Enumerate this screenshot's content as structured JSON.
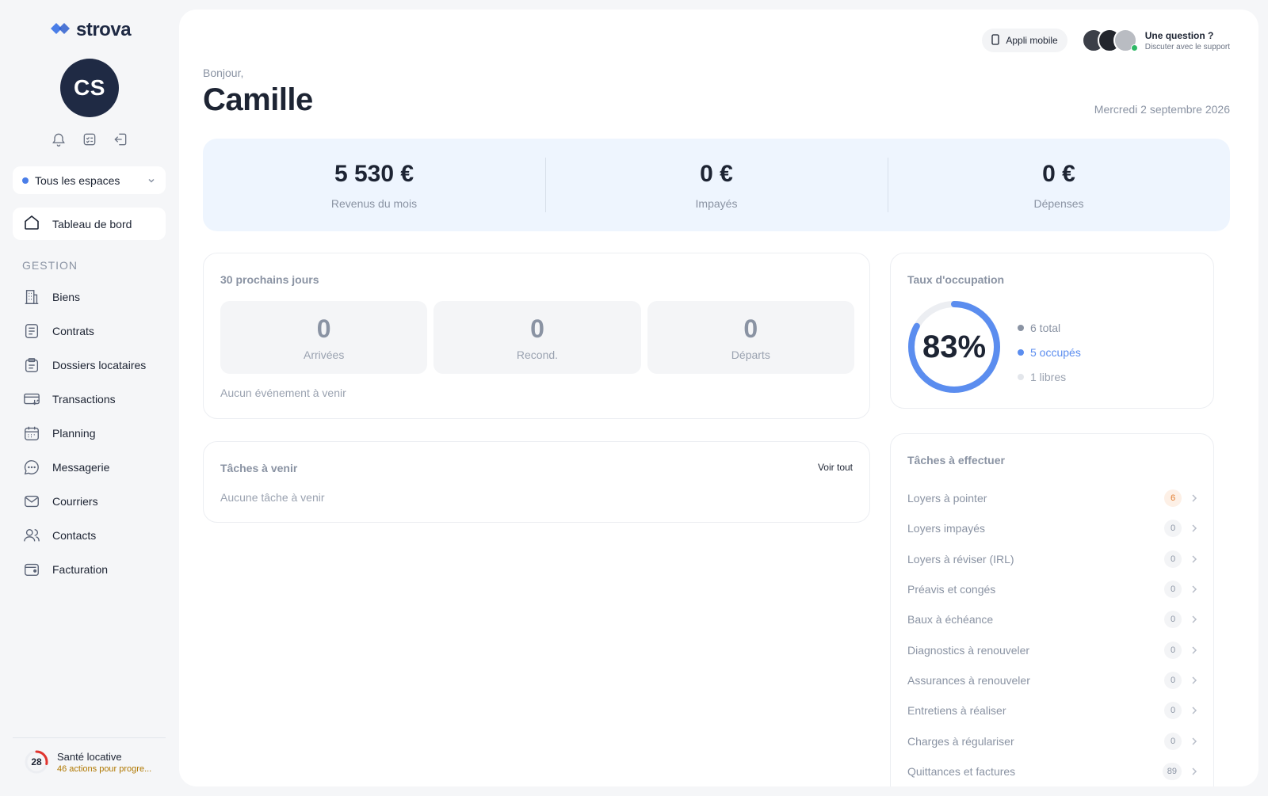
{
  "brand": {
    "name": "strova",
    "accent": "#4a7ee8"
  },
  "user": {
    "initials": "CS",
    "greeting": "Bonjour,",
    "name": "Camille"
  },
  "sidebar": {
    "space_selector": "Tous les espaces",
    "dashboard_label": "Tableau de bord",
    "section_title": "GESTION",
    "items": [
      {
        "label": "Biens",
        "icon": "building-icon"
      },
      {
        "label": "Contrats",
        "icon": "document-icon"
      },
      {
        "label": "Dossiers locataires",
        "icon": "clipboard-icon"
      },
      {
        "label": "Transactions",
        "icon": "card-transfer-icon"
      },
      {
        "label": "Planning",
        "icon": "calendar-icon"
      },
      {
        "label": "Messagerie",
        "icon": "chat-icon"
      },
      {
        "label": "Courriers",
        "icon": "mail-icon"
      },
      {
        "label": "Contacts",
        "icon": "users-icon"
      },
      {
        "label": "Facturation",
        "icon": "wallet-icon"
      }
    ],
    "health": {
      "score": "28",
      "title": "Santé locative",
      "subtitle": "46 actions pour progre...",
      "progress": 0.28
    }
  },
  "header": {
    "mobile_app": "Appli mobile",
    "support_title": "Une question ?",
    "support_subtitle": "Discuter avec le support",
    "date": "Mercredi 2 septembre 2026"
  },
  "kpis": [
    {
      "value": "5 530 €",
      "label": "Revenus du mois"
    },
    {
      "value": "0 €",
      "label": "Impayés"
    },
    {
      "value": "0 €",
      "label": "Dépenses"
    }
  ],
  "upcoming": {
    "title": "30 prochains jours",
    "stats": [
      {
        "value": "0",
        "label": "Arrivées"
      },
      {
        "value": "0",
        "label": "Recond."
      },
      {
        "value": "0",
        "label": "Départs"
      }
    ],
    "empty": "Aucun événement à venir"
  },
  "tasks_upcoming": {
    "title": "Tâches à venir",
    "see_all": "Voir tout",
    "empty": "Aucune tâche à venir"
  },
  "occupancy": {
    "title": "Taux d'occupation",
    "percent_label": "83%",
    "rate": 0.83,
    "legend": [
      {
        "label": "6 total",
        "color": "#8a93a3"
      },
      {
        "label": "5 occupés",
        "color": "#5b8def"
      },
      {
        "label": "1 libres",
        "color": "#e3e6eb"
      }
    ]
  },
  "todo": {
    "title": "Tâches à effectuer",
    "items": [
      {
        "label": "Loyers à pointer",
        "count": "6",
        "warn": true
      },
      {
        "label": "Loyers impayés",
        "count": "0"
      },
      {
        "label": "Loyers à réviser (IRL)",
        "count": "0"
      },
      {
        "label": "Préavis et congés",
        "count": "0"
      },
      {
        "label": "Baux à échéance",
        "count": "0"
      },
      {
        "label": "Diagnostics à renouveler",
        "count": "0"
      },
      {
        "label": "Assurances à renouveler",
        "count": "0"
      },
      {
        "label": "Entretiens à réaliser",
        "count": "0"
      },
      {
        "label": "Charges à régulariser",
        "count": "0"
      },
      {
        "label": "Quittances et factures",
        "count": "89"
      }
    ]
  }
}
